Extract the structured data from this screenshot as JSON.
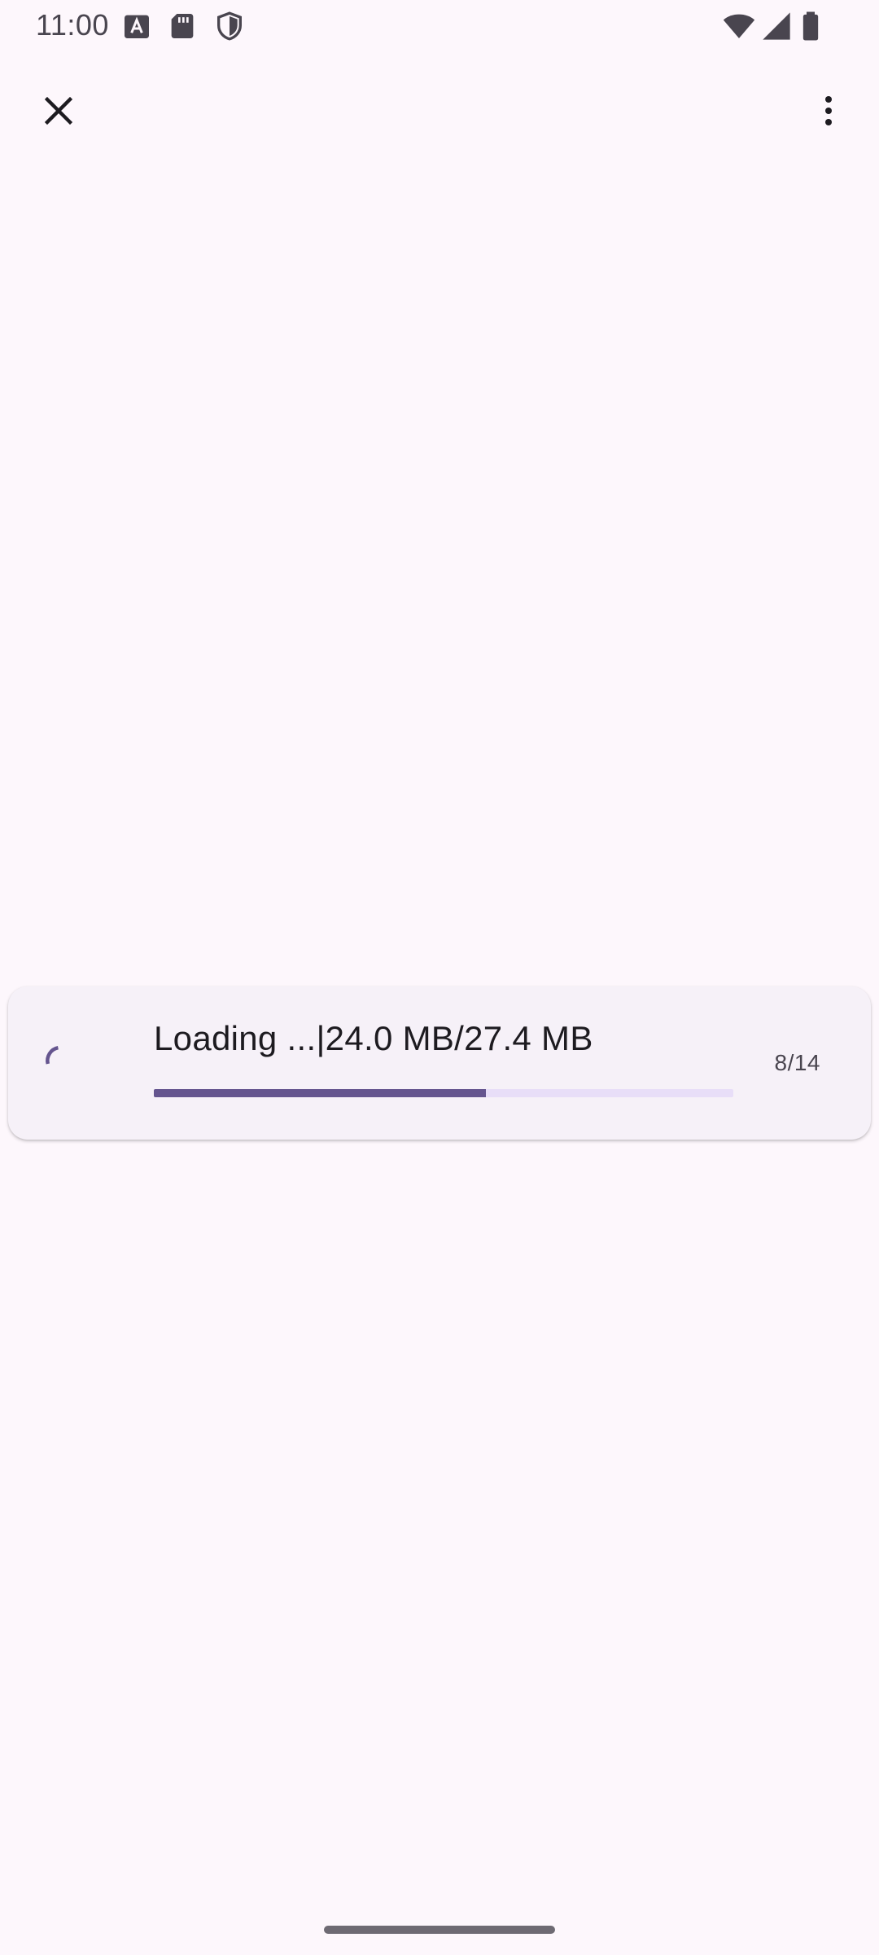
{
  "status_bar": {
    "time": "11:00",
    "left_icons": [
      "text-a-icon",
      "sd-card-icon",
      "shield-icon"
    ],
    "right_icons": [
      "wifi-icon",
      "signal-icon",
      "battery-icon"
    ]
  },
  "app_bar": {
    "close_icon": "close-icon",
    "more_icon": "more-vertical-icon"
  },
  "loading_card": {
    "status_text": "Loading ...|24.0 MB/27.4 MB",
    "progress_fraction": 0.5727,
    "page_counter": "8/14",
    "spinner_icon": "spinner-icon"
  },
  "colors": {
    "background": "#FDF7FC",
    "card": "#F6F1F8",
    "accent": "#65558F",
    "track": "#E8DEF8",
    "icon": "#1D1B20"
  }
}
